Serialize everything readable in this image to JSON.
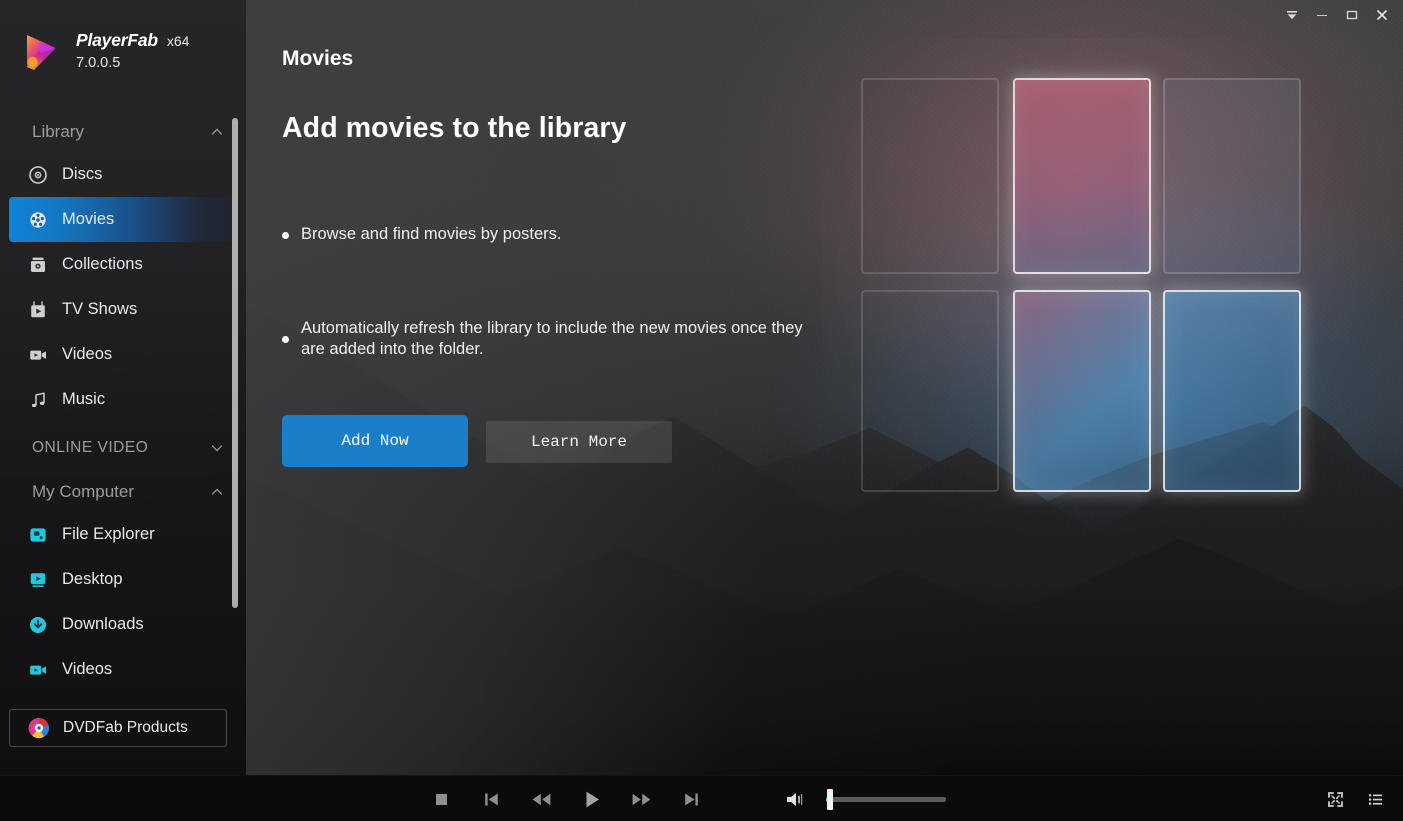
{
  "window": {
    "controls": [
      {
        "name": "collapse-button",
        "glyph": "collapse"
      },
      {
        "name": "minimize-button",
        "glyph": "minimize"
      },
      {
        "name": "maximize-button",
        "glyph": "maximize"
      },
      {
        "name": "close-button",
        "glyph": "close"
      }
    ]
  },
  "brand": {
    "name": "PlayerFab",
    "arch": "x64",
    "version": "7.0.0.5",
    "logo_icon": "playerfab-logo-icon"
  },
  "sidebar": {
    "groups": [
      {
        "title": "Library",
        "caps": false,
        "expanded": true,
        "chevron": "chevron-up-icon",
        "items": [
          {
            "label": "Discs",
            "icon": "disc-icon",
            "active": false
          },
          {
            "label": "Movies",
            "icon": "film-reel-icon",
            "active": true
          },
          {
            "label": "Collections",
            "icon": "collections-icon",
            "active": false
          },
          {
            "label": "TV Shows",
            "icon": "tv-icon",
            "active": false
          },
          {
            "label": "Videos",
            "icon": "video-camera-icon",
            "active": false
          },
          {
            "label": "Music",
            "icon": "music-note-icon",
            "active": false
          }
        ]
      },
      {
        "title": "ONLINE VIDEO",
        "caps": true,
        "expanded": false,
        "chevron": "chevron-down-icon",
        "items": []
      },
      {
        "title": "My Computer",
        "caps": false,
        "expanded": true,
        "chevron": "chevron-up-icon",
        "items": [
          {
            "label": "File Explorer",
            "icon": "folder-icon",
            "active": false
          },
          {
            "label": "Desktop",
            "icon": "desktop-icon",
            "active": false
          },
          {
            "label": "Downloads",
            "icon": "download-icon",
            "active": false
          },
          {
            "label": "Videos",
            "icon": "video-camera-icon",
            "active": false
          }
        ]
      }
    ],
    "dvdfab_products": {
      "label": "DVDFab Products",
      "icon": "dvdfab-logo-icon"
    },
    "scrollbar": {
      "name": "sidebar-scrollbar"
    }
  },
  "main": {
    "page_title": "Movies",
    "hero_title": "Add movies to the library",
    "bullets": [
      "Browse and find movies by posters.",
      "Automatically refresh the library to include the new movies once they are added into the folder."
    ],
    "add_now_label": "Add Now",
    "learn_more_label": "Learn More"
  },
  "player": {
    "transport": [
      {
        "name": "stop-button",
        "icon": "stop-icon"
      },
      {
        "name": "previous-button",
        "icon": "skip-previous-icon"
      },
      {
        "name": "rewind-button",
        "icon": "rewind-icon"
      },
      {
        "name": "play-button",
        "icon": "play-icon"
      },
      {
        "name": "forward-button",
        "icon": "fast-forward-icon"
      },
      {
        "name": "next-button",
        "icon": "skip-next-icon"
      }
    ],
    "volume": {
      "icon": "volume-icon",
      "level_percent": 4
    },
    "right_tools": [
      {
        "name": "fullscreen-button",
        "icon": "fullscreen-icon"
      },
      {
        "name": "playlist-button",
        "icon": "playlist-icon"
      }
    ]
  },
  "colors": {
    "accent_blue": "#1b7ec9",
    "active_nav": "#1182d6",
    "computer_icon_cyan": "#22c8e0",
    "volume_fill": "#3fd6c4",
    "sidebar_bg": "#1c1c1e",
    "main_bg": "#3e3e40",
    "player_bar": "#0b0b0c"
  }
}
